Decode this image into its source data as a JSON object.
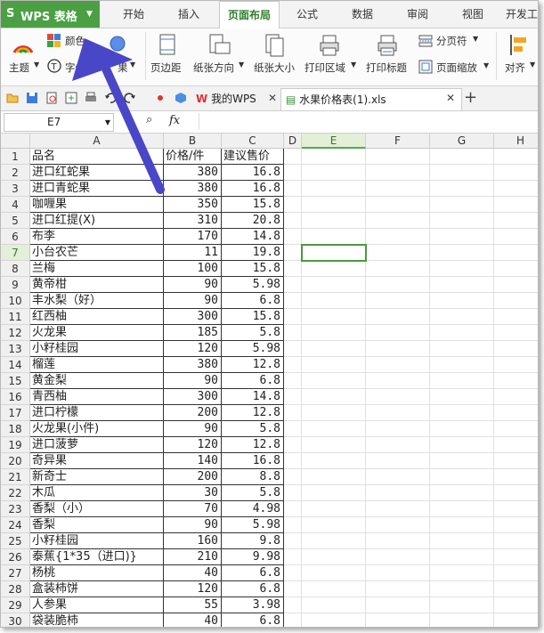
{
  "app": {
    "logo": "S",
    "title": "WPS 表格"
  },
  "menu_tabs": [
    "开始",
    "插入",
    "页面布局",
    "公式",
    "数据",
    "审阅",
    "视图",
    "开发工"
  ],
  "active_menu_tab": "页面布局",
  "ribbon": {
    "theme_label": "主题",
    "font_label": "字体",
    "color_label": "颜色",
    "effect_label": "果",
    "margin_label": "页边距",
    "orientation_label": "纸张方向",
    "size_label": "纸张大小",
    "print_area_label": "打印区域",
    "print_title_label": "打印标题",
    "page_break_label": "分页符",
    "page_zoom_label": "页面缩放",
    "align_label": "对齐"
  },
  "doc_tabs": {
    "wps_tab": "我的WPS",
    "file_tab": "水果价格表(1).xls"
  },
  "formula_bar": {
    "cell_ref": "E7",
    "fx": "fx"
  },
  "columns": [
    "A",
    "B",
    "C",
    "D",
    "E",
    "F",
    "G",
    "H"
  ],
  "selected_column": "E",
  "selected_row": "7",
  "header_row": {
    "a": "品名",
    "b": "价格/件",
    "c": "建议售价"
  },
  "rows": [
    {
      "n": "2",
      "a": "进口红蛇果",
      "b": "380",
      "c": "16.8"
    },
    {
      "n": "3",
      "a": "进口青蛇果",
      "b": "380",
      "c": "16.8"
    },
    {
      "n": "4",
      "a": "咖喱果",
      "b": "350",
      "c": "15.8"
    },
    {
      "n": "5",
      "a": "进口红提(X)",
      "b": "310",
      "c": "20.8"
    },
    {
      "n": "6",
      "a": "布李",
      "b": "170",
      "c": "14.8"
    },
    {
      "n": "7",
      "a": "小台农芒",
      "b": "11",
      "c": "19.8"
    },
    {
      "n": "8",
      "a": "兰梅",
      "b": "100",
      "c": "15.8"
    },
    {
      "n": "9",
      "a": "黄帝柑",
      "b": "90",
      "c": "5.98"
    },
    {
      "n": "10",
      "a": "丰水梨（好）",
      "b": "90",
      "c": "6.8"
    },
    {
      "n": "11",
      "a": "红西柚",
      "b": "300",
      "c": "15.8"
    },
    {
      "n": "12",
      "a": "火龙果",
      "b": "185",
      "c": "5.8"
    },
    {
      "n": "13",
      "a": "小籽桂园",
      "b": "120",
      "c": "5.98"
    },
    {
      "n": "14",
      "a": "榴莲",
      "b": "380",
      "c": "12.8"
    },
    {
      "n": "15",
      "a": "黄金梨",
      "b": "90",
      "c": "6.8"
    },
    {
      "n": "16",
      "a": "青西柚",
      "b": "300",
      "c": "14.8"
    },
    {
      "n": "17",
      "a": "进口柠檬",
      "b": "200",
      "c": "12.8"
    },
    {
      "n": "18",
      "a": "火龙果(小件)",
      "b": "90",
      "c": "5.8"
    },
    {
      "n": "19",
      "a": "进口菠萝",
      "b": "120",
      "c": "12.8"
    },
    {
      "n": "20",
      "a": "奇异果",
      "b": "140",
      "c": "16.8"
    },
    {
      "n": "21",
      "a": "新奇士",
      "b": "200",
      "c": "8.8"
    },
    {
      "n": "22",
      "a": "木瓜",
      "b": "30",
      "c": "5.8"
    },
    {
      "n": "23",
      "a": "香梨（小）",
      "b": "70",
      "c": "4.98"
    },
    {
      "n": "24",
      "a": "香梨",
      "b": "90",
      "c": "5.98"
    },
    {
      "n": "25",
      "a": "小籽桂园",
      "b": "160",
      "c": "9.8"
    },
    {
      "n": "26",
      "a": "泰蕉{1*35（进口)}",
      "b": "210",
      "c": "9.98"
    },
    {
      "n": "27",
      "a": "杨桃",
      "b": "40",
      "c": "6.8"
    },
    {
      "n": "28",
      "a": "盒装柿饼",
      "b": "120",
      "c": "6.8"
    },
    {
      "n": "29",
      "a": "人参果",
      "b": "55",
      "c": "3.98"
    },
    {
      "n": "30",
      "a": "袋装脆柿",
      "b": "40",
      "c": "6.8"
    }
  ],
  "colors": {
    "accent_green": "#4aa043",
    "arrow_blue": "#4a46c8"
  }
}
